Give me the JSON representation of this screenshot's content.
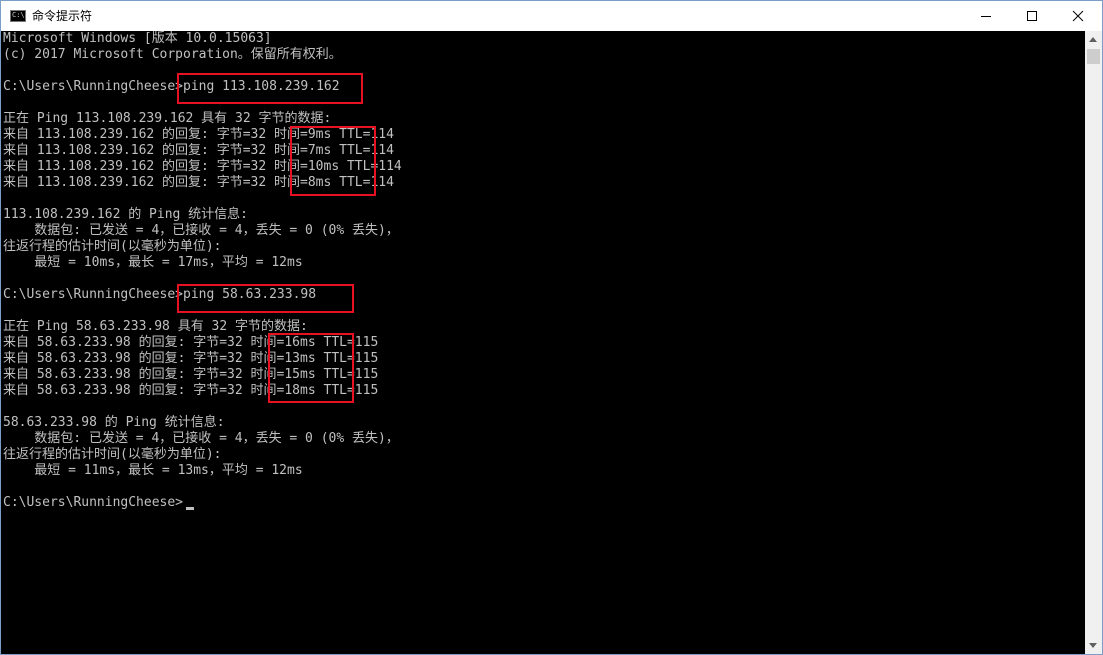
{
  "window": {
    "title": "命令提示符",
    "icon_text": "C:\\",
    "icon": "console-app-icon",
    "controls": [
      "minimize-icon",
      "maximize-icon",
      "close-icon"
    ]
  },
  "console": {
    "lines": [
      "Microsoft Windows [版本 10.0.15063]",
      "(c) 2017 Microsoft Corporation。保留所有权利。",
      "",
      "C:\\Users\\RunningCheese>ping 113.108.239.162",
      "",
      "正在 Ping 113.108.239.162 具有 32 字节的数据:",
      "来自 113.108.239.162 的回复: 字节=32 时间=9ms TTL=114",
      "来自 113.108.239.162 的回复: 字节=32 时间=7ms TTL=114",
      "来自 113.108.239.162 的回复: 字节=32 时间=10ms TTL=114",
      "来自 113.108.239.162 的回复: 字节=32 时间=8ms TTL=114",
      "",
      "113.108.239.162 的 Ping 统计信息:",
      "    数据包: 已发送 = 4，已接收 = 4，丢失 = 0 (0% 丢失)，",
      "往返行程的估计时间(以毫秒为单位):",
      "    最短 = 10ms，最长 = 17ms，平均 = 12ms",
      "",
      "C:\\Users\\RunningCheese>ping 58.63.233.98",
      "",
      "正在 Ping 58.63.233.98 具有 32 字节的数据:",
      "来自 58.63.233.98 的回复: 字节=32 时间=16ms TTL=115",
      "来自 58.63.233.98 的回复: 字节=32 时间=13ms TTL=115",
      "来自 58.63.233.98 的回复: 字节=32 时间=15ms TTL=115",
      "来自 58.63.233.98 的回复: 字节=32 时间=18ms TTL=115",
      "",
      "58.63.233.98 的 Ping 统计信息:",
      "    数据包: 已发送 = 4，已接收 = 4，丢失 = 0 (0% 丢失)，",
      "往返行程的估计时间(以毫秒为单位):",
      "    最短 = 11ms，最长 = 13ms，平均 = 12ms",
      "",
      "C:\\Users\\RunningCheese>"
    ]
  },
  "colors": {
    "console_background": "#000000",
    "console_text": "#c0c0c0",
    "highlight_border": "#e81123",
    "titlebar_background": "#ffffff"
  }
}
